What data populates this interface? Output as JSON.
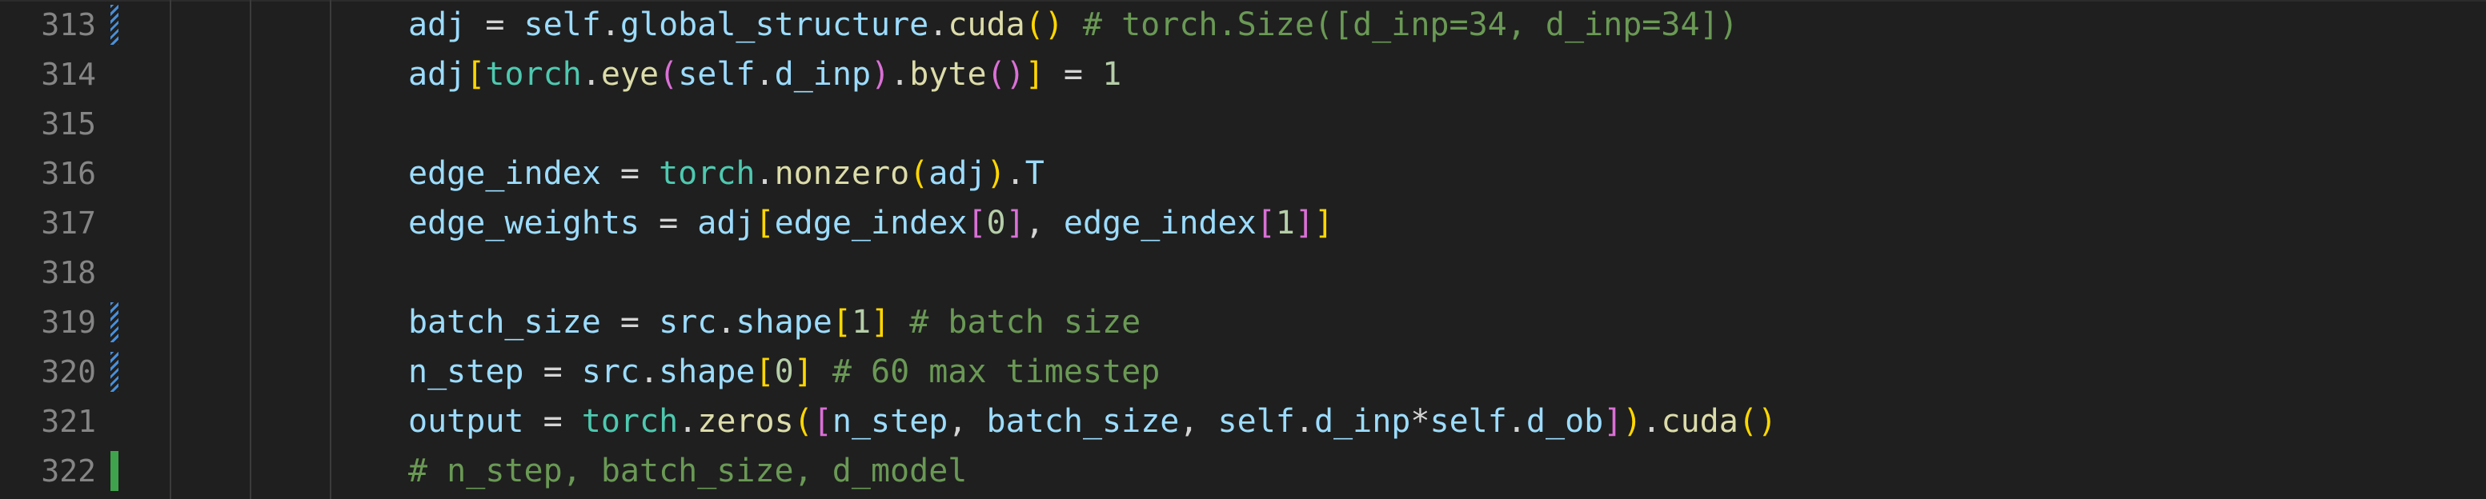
{
  "colors": {
    "background": "#1f1f1f",
    "line_number": "#858585",
    "variable": "#9cdcfe",
    "function": "#dcdcaa",
    "module": "#4ec9b0",
    "number": "#b5cea8",
    "comment": "#6a9955",
    "bracket_level1": "#ffd700",
    "bracket_level2": "#da70d6",
    "modified_gutter": "#4a8fd8",
    "added_gutter": "#3fa34d"
  },
  "lines": [
    {
      "num": "313",
      "gutter": "modified",
      "t": [
        "adj",
        " = ",
        "self",
        ".",
        "global_structure",
        ".",
        "cuda",
        "(",
        ")",
        " # torch.Size([d_inp=34, d_inp=34])"
      ]
    },
    {
      "num": "314",
      "gutter": "none",
      "t": [
        "adj",
        "[",
        "torch",
        ".",
        "eye",
        "(",
        "self",
        ".",
        "d_inp",
        ")",
        ".",
        "byte",
        "(",
        ")",
        "]",
        " = ",
        "1"
      ]
    },
    {
      "num": "315",
      "gutter": "none",
      "t": []
    },
    {
      "num": "316",
      "gutter": "none",
      "t": [
        "edge_index",
        " = ",
        "torch",
        ".",
        "nonzero",
        "(",
        "adj",
        ")",
        ".",
        "T"
      ]
    },
    {
      "num": "317",
      "gutter": "none",
      "t": [
        "edge_weights",
        " = ",
        "adj",
        "[",
        "edge_index",
        "[",
        "0",
        "]",
        ", ",
        "edge_index",
        "[",
        "1",
        "]",
        "]"
      ]
    },
    {
      "num": "318",
      "gutter": "none",
      "t": []
    },
    {
      "num": "319",
      "gutter": "modified",
      "t": [
        "batch_size",
        " = ",
        "src",
        ".",
        "shape",
        "[",
        "1",
        "]",
        " # batch size"
      ]
    },
    {
      "num": "320",
      "gutter": "modified",
      "t": [
        "n_step",
        " = ",
        "src",
        ".",
        "shape",
        "[",
        "0",
        "]",
        " # 60 max timestep"
      ]
    },
    {
      "num": "321",
      "gutter": "none",
      "t": [
        "output",
        " = ",
        "torch",
        ".",
        "zeros",
        "(",
        "[",
        "n_step",
        ", ",
        "batch_size",
        ", ",
        "self",
        ".",
        "d_inp",
        "*",
        "self",
        ".",
        "d_ob",
        "]",
        ")",
        ".",
        "cuda",
        "(",
        ")"
      ]
    },
    {
      "num": "322",
      "gutter": "added",
      "t": [
        "# n_step, batch_size, d_model"
      ]
    }
  ]
}
